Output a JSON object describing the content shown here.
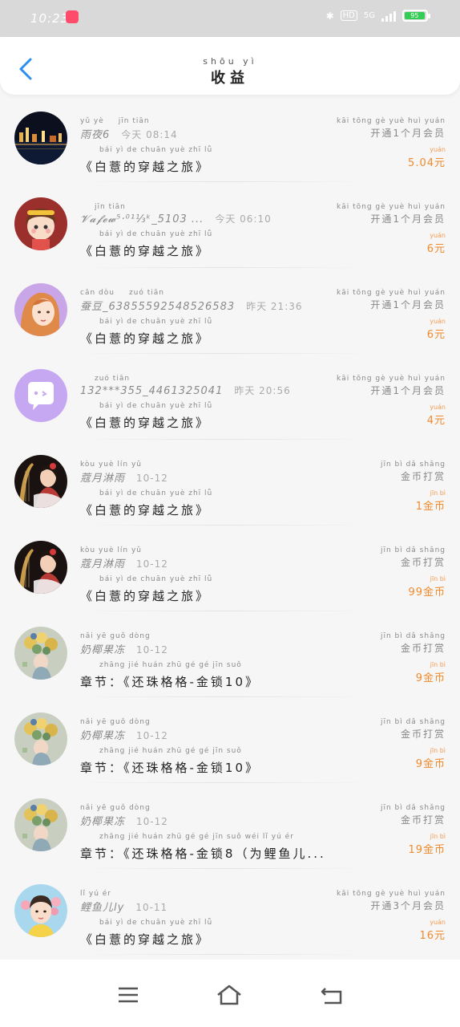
{
  "status": {
    "time": "10:23",
    "hd": "HD",
    "net": "5G",
    "battery": "95"
  },
  "header": {
    "title_pinyin": "shōu yì",
    "title": "收益"
  },
  "items": [
    {
      "name_pinyin": "yǔ yè",
      "name": "雨夜6",
      "time_pinyin": "jīn tiān",
      "time": "今天 08:14",
      "work_pinyin": "bái yì de chuān yuè zhī lǚ",
      "work": "《白薏的穿越之旅》",
      "type_pinyin": "kāi tōng gè yuè huì yuán",
      "type": "开通1个月会员",
      "amount_pinyin": "yuán",
      "amount": "5.04元",
      "avatar": "night-city"
    },
    {
      "name_pinyin": "",
      "name": "𝓥𝓪𝓯𝓮𝔀⁵·⁰¹⅓ᵏ_5103 ...",
      "time_pinyin": "jīn tiān",
      "time": "今天 06:10",
      "work_pinyin": "bái yì de chuān yuè zhī lǚ",
      "work": "《白薏的穿越之旅》",
      "type_pinyin": "kāi tōng gè yuè huì yuán",
      "type": "开通1个月会员",
      "amount_pinyin": "yuán",
      "amount": "6元",
      "avatar": "cartoon-girl-red"
    },
    {
      "name_pinyin": "cān dòu",
      "name": "蚕豆_63855592548526583",
      "time_pinyin": "zuó tiān",
      "time": "昨天 21:36",
      "work_pinyin": "bái yì de chuān yuè zhī lǚ",
      "work": "《白薏的穿越之旅》",
      "type_pinyin": "kāi tōng gè yuè huì yuán",
      "type": "开通1个月会员",
      "amount_pinyin": "yuán",
      "amount": "6元",
      "avatar": "girl-orange-hair"
    },
    {
      "name_pinyin": "",
      "name": "132***355_4461325041",
      "time_pinyin": "zuó tiān",
      "time": "昨天 20:56",
      "work_pinyin": "bái yì de chuān yuè zhī lǚ",
      "work": "《白薏的穿越之旅》",
      "type_pinyin": "kāi tōng gè yuè huì yuán",
      "type": "开通1个月会员",
      "amount_pinyin": "yuán",
      "amount": "4元",
      "avatar": "default-chat"
    },
    {
      "name_pinyin": "kòu yuè lín yǔ",
      "name": "蔻月淋雨",
      "time_pinyin": "",
      "time": "10-12",
      "work_pinyin": "bái yì de chuān yuè zhī lǚ",
      "work": "《白薏的穿越之旅》",
      "type_pinyin": "jīn bì dǎ shǎng",
      "type": "金币打赏",
      "amount_pinyin": "jīn bì",
      "amount": "1金币",
      "avatar": "harp-girl"
    },
    {
      "name_pinyin": "kòu yuè lín yǔ",
      "name": "蔻月淋雨",
      "time_pinyin": "",
      "time": "10-12",
      "work_pinyin": "bái yì de chuān yuè zhī lǚ",
      "work": "《白薏的穿越之旅》",
      "type_pinyin": "jīn bì dǎ shǎng",
      "type": "金币打赏",
      "amount_pinyin": "jīn bì",
      "amount": "99金币",
      "avatar": "harp-girl"
    },
    {
      "name_pinyin": "nǎi yē guǒ dòng",
      "name": "奶椰果冻",
      "time_pinyin": "",
      "time": "10-12",
      "work_pinyin": "zhāng jié    huán zhū gé gé jīn suǒ",
      "work": "章节：《还珠格格-金锁10》",
      "type_pinyin": "jīn bì dǎ shǎng",
      "type": "金币打赏",
      "amount_pinyin": "jīn bì",
      "amount": "9金币",
      "avatar": "flower-girl"
    },
    {
      "name_pinyin": "nǎi yē guǒ dòng",
      "name": "奶椰果冻",
      "time_pinyin": "",
      "time": "10-12",
      "work_pinyin": "zhāng jié    huán zhū gé gé jīn suǒ",
      "work": "章节：《还珠格格-金锁10》",
      "type_pinyin": "jīn bì dǎ shǎng",
      "type": "金币打赏",
      "amount_pinyin": "jīn bì",
      "amount": "9金币",
      "avatar": "flower-girl"
    },
    {
      "name_pinyin": "nǎi yē guǒ dòng",
      "name": "奶椰果冻",
      "time_pinyin": "",
      "time": "10-12",
      "work_pinyin": "zhāng jié    huán zhū gé gé jīn suǒ   wéi lǐ yú ér",
      "work": "章节：《还珠格格-金锁8（为鲤鱼儿...",
      "type_pinyin": "jīn bì dǎ shǎng",
      "type": "金币打赏",
      "amount_pinyin": "jīn bì",
      "amount": "19金币",
      "avatar": "flower-girl"
    },
    {
      "name_pinyin": "lǐ yú ér",
      "name": "鲤鱼儿ly",
      "time_pinyin": "",
      "time": "10-11",
      "work_pinyin": "bái yì de chuān yuè zhī lǚ",
      "work": "《白薏的穿越之旅》",
      "type_pinyin": "kāi tōng gè yuè huì yuán",
      "type": "开通3个月会员",
      "amount_pinyin": "yuán",
      "amount": "16元",
      "avatar": "boy-flowers"
    }
  ]
}
